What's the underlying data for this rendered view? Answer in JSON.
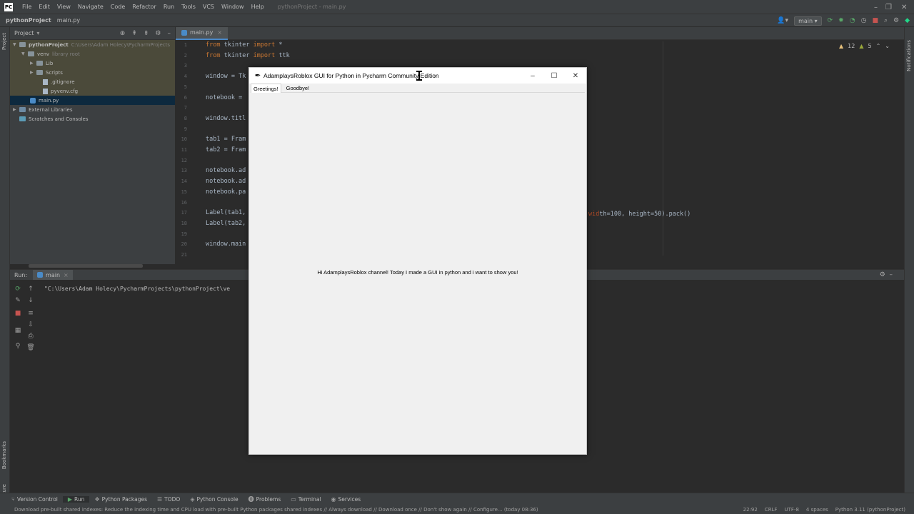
{
  "menubar": {
    "items": [
      "File",
      "Edit",
      "View",
      "Navigate",
      "Code",
      "Refactor",
      "Run",
      "Tools",
      "VCS",
      "Window",
      "Help"
    ],
    "project_title": "pythonProject - main.py"
  },
  "navbar": {
    "project": "pythonProject",
    "file": "main.py",
    "branch": "main"
  },
  "project_panel": {
    "title": "Project",
    "tree": [
      {
        "label": "pythonProject",
        "extra": "C:\\Users\\Adam Holecy\\PycharmProjects",
        "level": 0,
        "type": "folder",
        "expanded": true
      },
      {
        "label": "venv",
        "extra": "library root",
        "level": 1,
        "type": "folder",
        "expanded": true
      },
      {
        "label": "Lib",
        "extra": "",
        "level": 2,
        "type": "folder",
        "expanded": false
      },
      {
        "label": "Scripts",
        "extra": "",
        "level": 2,
        "type": "folder",
        "expanded": false
      },
      {
        "label": ".gitignore",
        "extra": "",
        "level": 3,
        "type": "file"
      },
      {
        "label": "pyvenv.cfg",
        "extra": "",
        "level": 3,
        "type": "file"
      },
      {
        "label": "main.py",
        "extra": "",
        "level": 1,
        "type": "py"
      },
      {
        "label": "External Libraries",
        "extra": "",
        "level": 0,
        "type": "lib"
      },
      {
        "label": "Scratches and Consoles",
        "extra": "",
        "level": 0,
        "type": "scratch"
      }
    ]
  },
  "editor": {
    "tab": "main.py",
    "inspections": {
      "warnings": "12",
      "weak": "5"
    },
    "lines": [
      {
        "n": "1",
        "t": "from tkinter import *"
      },
      {
        "n": "2",
        "t": "from tkinter import ttk"
      },
      {
        "n": "3",
        "t": ""
      },
      {
        "n": "4",
        "t": "window = Tk"
      },
      {
        "n": "5",
        "t": ""
      },
      {
        "n": "6",
        "t": "notebook ="
      },
      {
        "n": "7",
        "t": ""
      },
      {
        "n": "8",
        "t": "window.titl"
      },
      {
        "n": "9",
        "t": ""
      },
      {
        "n": "10",
        "t": "tab1 = Fram"
      },
      {
        "n": "11",
        "t": "tab2 = Fram"
      },
      {
        "n": "12",
        "t": ""
      },
      {
        "n": "13",
        "t": "notebook.ad"
      },
      {
        "n": "14",
        "t": "notebook.ad"
      },
      {
        "n": "15",
        "t": "notebook.pa"
      },
      {
        "n": "16",
        "t": ""
      },
      {
        "n": "17",
        "t": "Label(tab1,"
      },
      {
        "n": "18",
        "t": "Label(tab2,"
      },
      {
        "n": "19",
        "t": ""
      },
      {
        "n": "20",
        "t": "window.main"
      },
      {
        "n": "21",
        "t": ""
      }
    ],
    "line17_tail": "th=100, height=50).pack()"
  },
  "run_panel": {
    "label": "Run:",
    "tab": "main",
    "output": "\"C:\\Users\\Adam Holecy\\PycharmProjects\\pythonProject\\ve"
  },
  "bottom_tools": [
    "Version Control",
    "Run",
    "Python Packages",
    "TODO",
    "Python Console",
    "Problems",
    "Terminal",
    "Services"
  ],
  "statusbar": {
    "message": "Download pre-built shared indexes: Reduce the indexing time and CPU load with pre-built Python packages shared indexes // Always download // Download once // Don't show again // Configure... (today 08:36)",
    "position": "22:92",
    "line_sep": "CRLF",
    "encoding": "UTF-8",
    "indent": "4 spaces",
    "interpreter": "Python 3.11 (pythonProject)"
  },
  "tk_window": {
    "title": "AdamplaysRoblox GUI for Python in Pycharm Community Edition",
    "tabs": [
      "Greetings!",
      "Goodbye!"
    ],
    "label": "Hi AdamplaysRoblox channel! Today I made a GUI in python and i want to show you!"
  },
  "side_labels": {
    "project": "Project",
    "notifications": "Notifications",
    "bookmarks": "Bookmarks",
    "structure": "Structure"
  }
}
